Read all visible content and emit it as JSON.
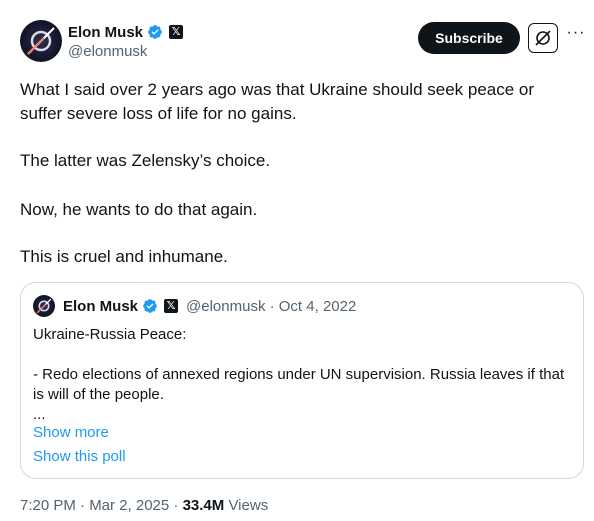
{
  "author": {
    "display_name": "Elon Musk",
    "handle": "@elonmusk",
    "verified_icon": "verified-badge-icon",
    "affiliation_icon": "x-logo-icon"
  },
  "actions": {
    "subscribe_label": "Subscribe",
    "grok_icon": "grok-icon",
    "more_icon": "more-icon",
    "more_glyph": "···"
  },
  "tweet": {
    "paragraphs": [
      "What I said over 2 years ago was that Ukraine should seek peace or suffer severe loss of life for no gains.",
      "The latter was Zelensky’s choice.",
      "Now, he wants to do that again.",
      "This is cruel and inhumane."
    ]
  },
  "quote": {
    "display_name": "Elon Musk",
    "handle_date": "@elonmusk · Oct 4, 2022",
    "lines": [
      "Ukraine-Russia Peace:",
      "- Redo elections of annexed regions under UN supervision. Russia leaves if that is will of the people.",
      "..."
    ],
    "show_more": "Show more",
    "show_poll": "Show this poll"
  },
  "footer": {
    "timestamp": "7:20 PM · Mar 2, 2025 · ",
    "views_count": "33.4M",
    "views_label": " Views"
  },
  "colors": {
    "text": "#0f1419",
    "secondary": "#536471",
    "link": "#1d9bf0",
    "verified": "#1d9bf0",
    "border": "#cfd9de"
  }
}
